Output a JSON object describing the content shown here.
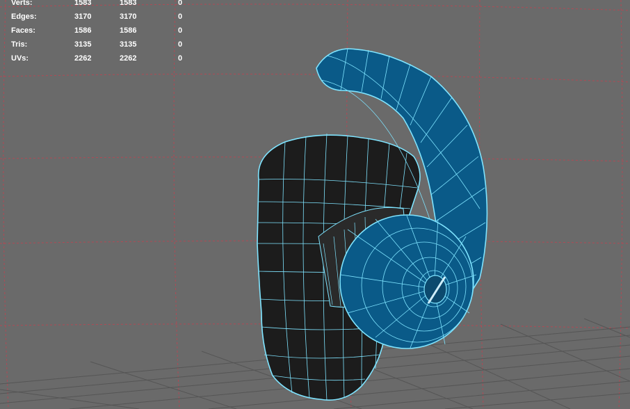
{
  "heads_up_display": {
    "rows": [
      {
        "label": "Verts:",
        "total": "1583",
        "selected": "1583",
        "extra": "0"
      },
      {
        "label": "Edges:",
        "total": "3170",
        "selected": "3170",
        "extra": "0"
      },
      {
        "label": "Faces:",
        "total": "1586",
        "selected": "1586",
        "extra": "0"
      },
      {
        "label": "Tris:",
        "total": "3135",
        "selected": "3135",
        "extra": "0"
      },
      {
        "label": "UVs:",
        "total": "2262",
        "selected": "2262",
        "extra": "0"
      }
    ]
  },
  "colors": {
    "background": "#6a6a6a",
    "grid_line": "#5a5a5a",
    "wireframe": "#7fe4ff",
    "body_dark": "#1c1c1c",
    "body_blue": "#0a5a88",
    "guide_red": "#b04a55"
  }
}
